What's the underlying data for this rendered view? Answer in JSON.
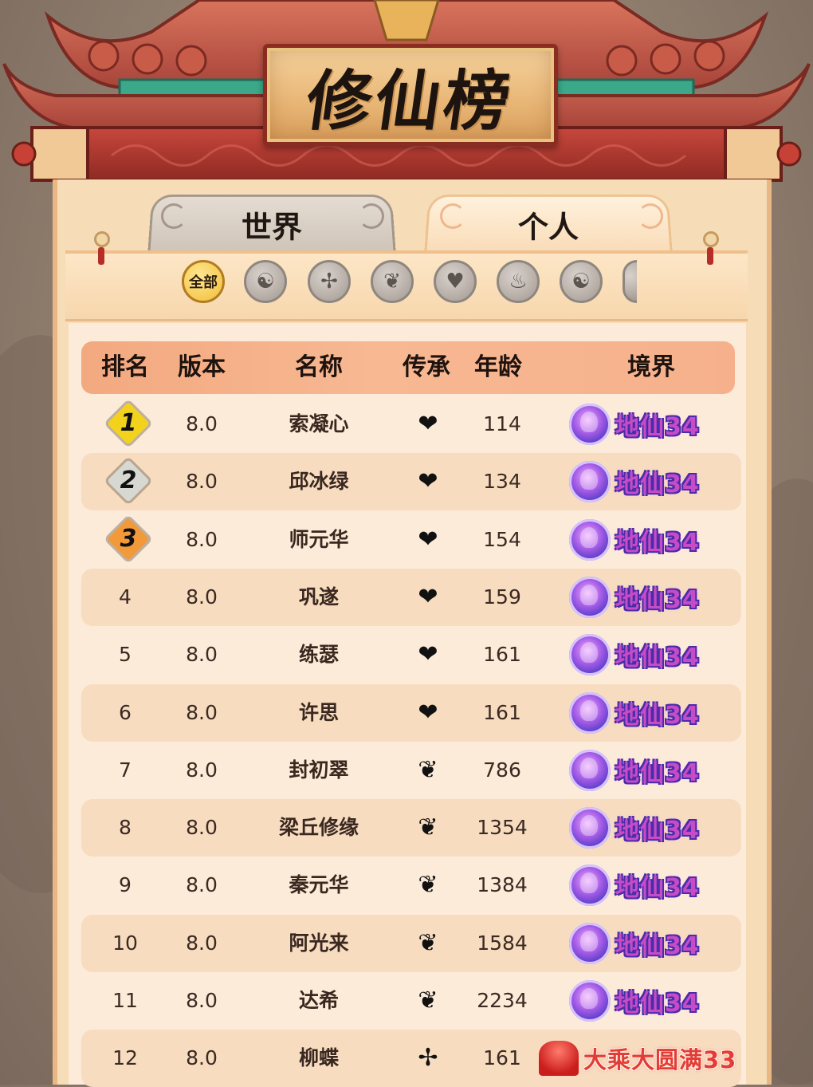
{
  "title": "修仙榜",
  "tabs": [
    {
      "label": "世界",
      "active": false
    },
    {
      "label": "个人",
      "active": true
    }
  ],
  "filters": [
    {
      "label": "全部",
      "icon": "all-text",
      "active": true
    },
    {
      "label": "",
      "icon": "yin-yang-icon"
    },
    {
      "label": "",
      "icon": "sword-emblem-icon"
    },
    {
      "label": "",
      "icon": "book-icon"
    },
    {
      "label": "",
      "icon": "heart-icon"
    },
    {
      "label": "",
      "icon": "flame-icon"
    },
    {
      "label": "",
      "icon": "taiji-icon"
    },
    {
      "label": "",
      "icon": "more-icon"
    }
  ],
  "columns": [
    "排名",
    "版本",
    "名称",
    "传承",
    "年龄",
    "境界"
  ],
  "rows": [
    {
      "rank": "1",
      "version": "8.0",
      "name": "索凝心",
      "inheritance": "heart",
      "age": "114",
      "realm": "地仙34"
    },
    {
      "rank": "2",
      "version": "8.0",
      "name": "邱冰绿",
      "inheritance": "heart",
      "age": "134",
      "realm": "地仙34"
    },
    {
      "rank": "3",
      "version": "8.0",
      "name": "师元华",
      "inheritance": "heart",
      "age": "154",
      "realm": "地仙34"
    },
    {
      "rank": "4",
      "version": "8.0",
      "name": "巩遂",
      "inheritance": "heart",
      "age": "159",
      "realm": "地仙34"
    },
    {
      "rank": "5",
      "version": "8.0",
      "name": "练瑟",
      "inheritance": "heart",
      "age": "161",
      "realm": "地仙34"
    },
    {
      "rank": "6",
      "version": "8.0",
      "name": "许思",
      "inheritance": "heart",
      "age": "161",
      "realm": "地仙34"
    },
    {
      "rank": "7",
      "version": "8.0",
      "name": "封初翠",
      "inheritance": "book",
      "age": "786",
      "realm": "地仙34"
    },
    {
      "rank": "8",
      "version": "8.0",
      "name": "梁丘修缘",
      "inheritance": "book",
      "age": "1354",
      "realm": "地仙34"
    },
    {
      "rank": "9",
      "version": "8.0",
      "name": "秦元华",
      "inheritance": "book",
      "age": "1384",
      "realm": "地仙34"
    },
    {
      "rank": "10",
      "version": "8.0",
      "name": "阿光来",
      "inheritance": "book",
      "age": "1584",
      "realm": "地仙34"
    },
    {
      "rank": "11",
      "version": "8.0",
      "name": "达希",
      "inheritance": "book",
      "age": "2234",
      "realm": "地仙34"
    },
    {
      "rank": "12",
      "version": "8.0",
      "name": "柳蝶",
      "inheritance": "sword",
      "age": "161",
      "realm": "大乘大圆满33"
    }
  ],
  "colors": {
    "rank1": "#f2d21c",
    "rank2": "#d8d8d2",
    "rank3": "#f29a3a",
    "realm_purple": "#c64bc7",
    "realm_red": "#e33d37"
  }
}
